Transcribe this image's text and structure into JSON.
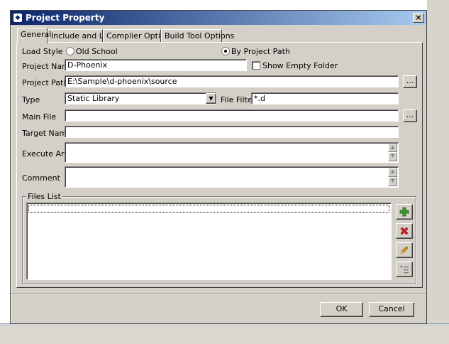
{
  "window": {
    "title": "Project Property",
    "close_glyph": "×"
  },
  "tabs": [
    {
      "label": "General",
      "active": true
    },
    {
      "label": "Include and Libs"
    },
    {
      "label": "Complier Options"
    },
    {
      "label": "Build Tool Options"
    }
  ],
  "form": {
    "load_style_label": "Load Style",
    "radio_old_school": "Old School",
    "radio_by_project_path": "By Project Path",
    "selected_load_style": "By Project Path",
    "project_name_label": "Project Name",
    "project_name_value": "D-Phoenix",
    "show_empty_folder_label": "Show Empty Folder",
    "show_empty_folder_checked": false,
    "project_path_label": "Project Path",
    "project_path_value": "E:\\Sample\\d-phoenix\\source",
    "browse_label": "...",
    "type_label": "Type",
    "type_value": "Static Library",
    "file_filter_label": "File Filter",
    "file_filter_value": "*.d",
    "main_file_label": "Main File",
    "main_file_value": "",
    "target_name_label": "Target Name",
    "target_name_value": "",
    "execute_args_label": "Execute Args",
    "execute_args_value": "",
    "comment_label": "Comment",
    "comment_value": ""
  },
  "files": {
    "legend": "Files List",
    "items": [
      ""
    ],
    "tools": [
      {
        "icon": "add-icon",
        "color": "#3a9a2a"
      },
      {
        "icon": "delete-icon",
        "color": "#d42020"
      },
      {
        "icon": "edit-icon",
        "color": "#e0a020"
      },
      {
        "icon": "move-icon",
        "color": "#4a6fa5"
      }
    ]
  },
  "footer": {
    "ok_label": "OK",
    "cancel_label": "Cancel"
  },
  "colors": {
    "dialog_face": "#d4d0c8",
    "title_start": "#0a246a",
    "title_end": "#a6caf0"
  }
}
